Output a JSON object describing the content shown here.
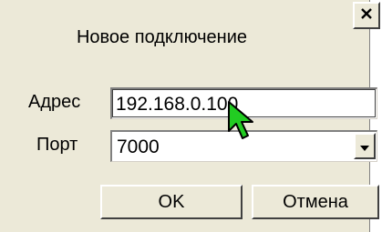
{
  "dialog": {
    "title": "Новое подключение",
    "close_label": "x"
  },
  "form": {
    "address_label": "Адрес",
    "address_value": "192.168.0.100",
    "port_label": "Порт",
    "port_value": "7000"
  },
  "buttons": {
    "ok_label": "OK",
    "cancel_label": "Отмена"
  },
  "icons": {
    "close": "close-icon",
    "dropdown": "chevron-down-icon",
    "cursor": "mouse-pointer-icon"
  },
  "colors": {
    "dialog_background": "#ece9d8",
    "cursor_fill": "#22cc22"
  }
}
